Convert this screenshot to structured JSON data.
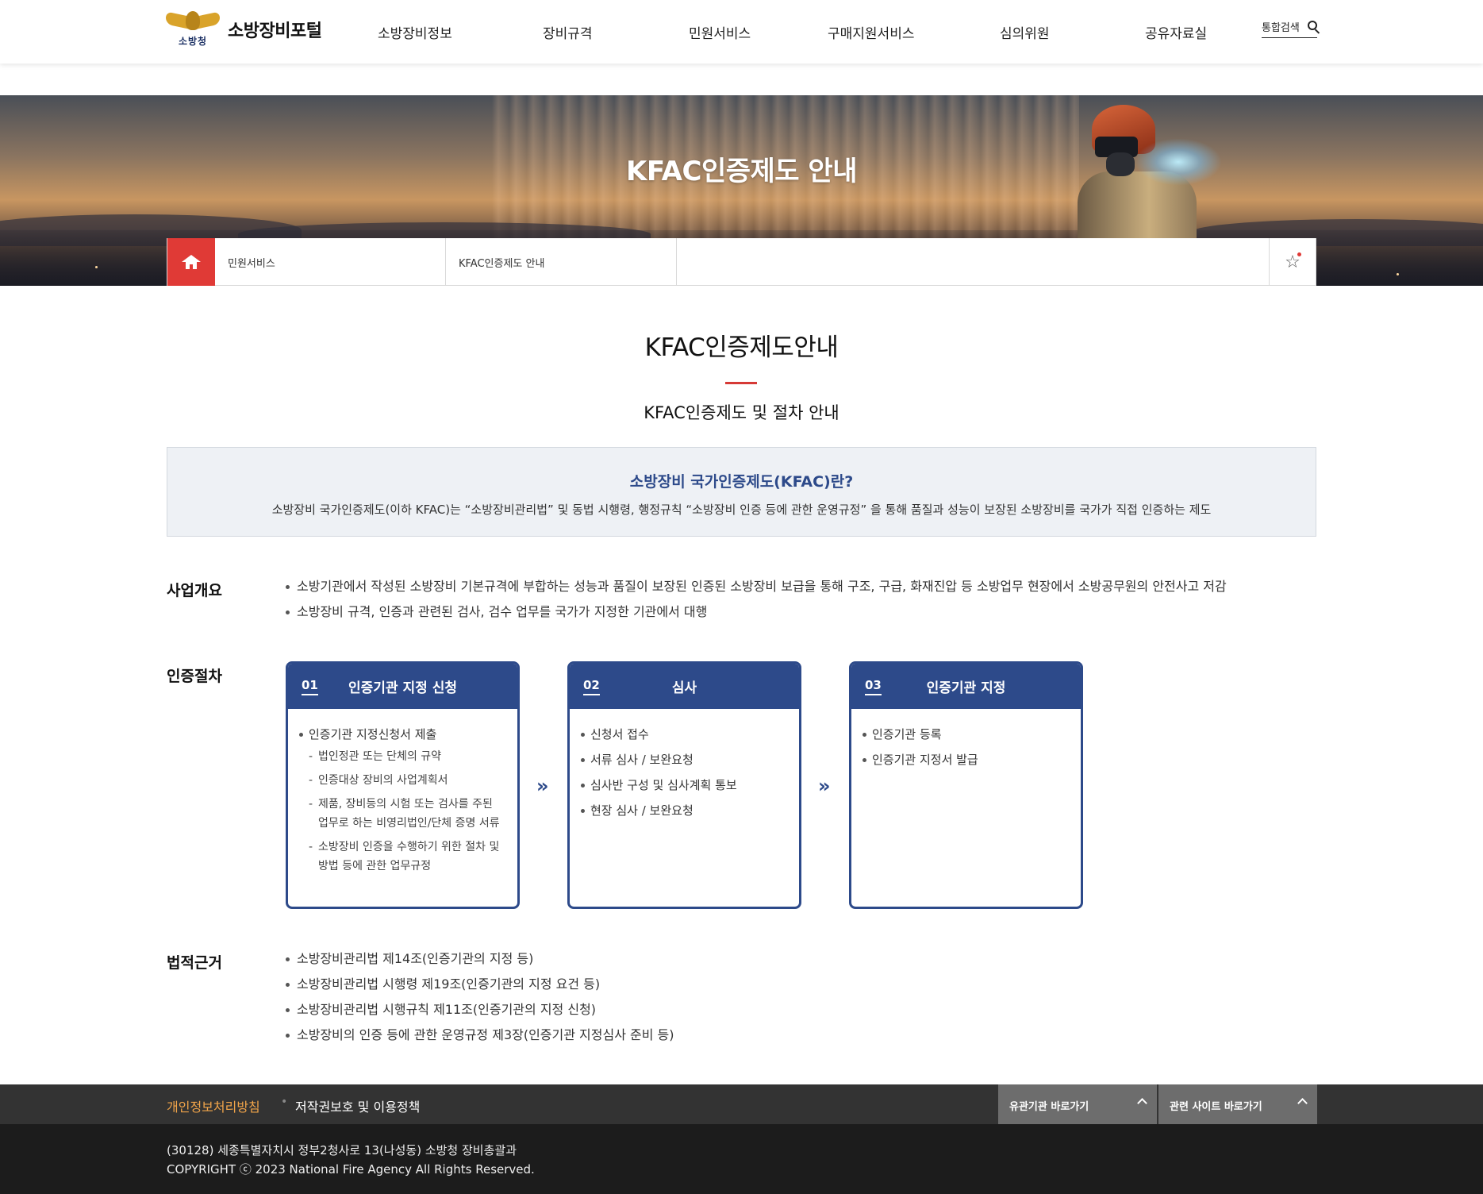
{
  "header": {
    "logo_org": "소방청",
    "logo_text": "소방장비포털",
    "nav": [
      "소방장비정보",
      "장비규격",
      "민원서비스",
      "구매지원서비스",
      "심의위원",
      "공유자료실"
    ],
    "search_label": "통합검색"
  },
  "hero": {
    "title": "KFAC인증제도 안내"
  },
  "breadcrumb": {
    "level1": "민원서비스",
    "level2": "KFAC인증제도 안내"
  },
  "page": {
    "title": "KFAC인증제도안내",
    "subtitle": "KFAC인증제도 및 절차 안내"
  },
  "intro": {
    "title": "소방장비 국가인증제도(KFAC)란?",
    "desc": "소방장비 국가인증제도(이하 KFAC)는 “소방장비관리법” 및 동법 시행령, 행정규칙 “소방장비 인증 등에 관한 운영규정” 을 통해 품질과 성능이 보장된 소방장비를 국가가 직접 인증하는 제도"
  },
  "overview": {
    "label": "사업개요",
    "items": [
      "소방기관에서 작성된 소방장비 기본규격에 부합하는 성능과 품질이 보장된 인증된 소방장비 보급을 통해 구조, 구급, 화재진압 등 소방업무 현장에서 소방공무원의 안전사고 저감",
      "소방장비 규격, 인증과 관련된 검사, 검수 업무를 국가가 지정한 기관에서 대행"
    ]
  },
  "procedure": {
    "label": "인증절차",
    "steps": [
      {
        "num": "01",
        "title": "인증기관 지정 신청",
        "items": [
          "인증기관 지정신청서 제출"
        ],
        "subitems": [
          "법인정관 또는 단체의 규약",
          "인증대상 장비의 사업계획서",
          "제품, 장비등의 시험 또는 검사를 주된 업무로 하는 비영리법인/단체 증명 서류",
          "소방장비 인증을 수행하기 위한 절차 및 방법 등에 관한 업무규정"
        ]
      },
      {
        "num": "02",
        "title": "심사",
        "items": [
          "신청서 접수",
          "서류 심사 / 보완요청",
          "심사반 구성 및 심사계획 통보",
          "현장 심사 / 보완요청"
        ]
      },
      {
        "num": "03",
        "title": "인증기관 지정",
        "items": [
          "인증기관 등록",
          "인증기관 지정서 발급"
        ]
      }
    ],
    "arrow_glyph": "»"
  },
  "legal": {
    "label": "법적근거",
    "items": [
      "소방장비관리법 제14조(인증기관의 지정 등)",
      "소방장비관리법 시행령 제19조(인증기관의 지정 요건 등)",
      "소방장비관리법 시행규칙 제11조(인증기관의 지정 신청)",
      "소방장비의 인증 등에 관한 운영규정 제3장(인증기관 지정심사 준비 등)"
    ]
  },
  "footer": {
    "privacy": "개인정보처리방침",
    "separator": "•",
    "copyright_policy": "저작권보호 및 이용정책",
    "related_org": "유관기관 바로가기",
    "related_site": "관련 사이트 바로가기",
    "address": "(30128) 세종특별자치시 정부2청사로 13(나성동) 소방청 장비총괄과",
    "copyright": "COPYRIGHT ⓒ 2023 National Fire Agency All Rights Reserved."
  },
  "colors": {
    "brand_red": "#e03a36",
    "navy": "#2d4a8a",
    "footer_orange": "#f2a54a"
  },
  "icons": [
    "emblem-icon",
    "search-icon",
    "home-icon",
    "star-icon",
    "double-chevron-icon",
    "chevron-up-icon"
  ]
}
